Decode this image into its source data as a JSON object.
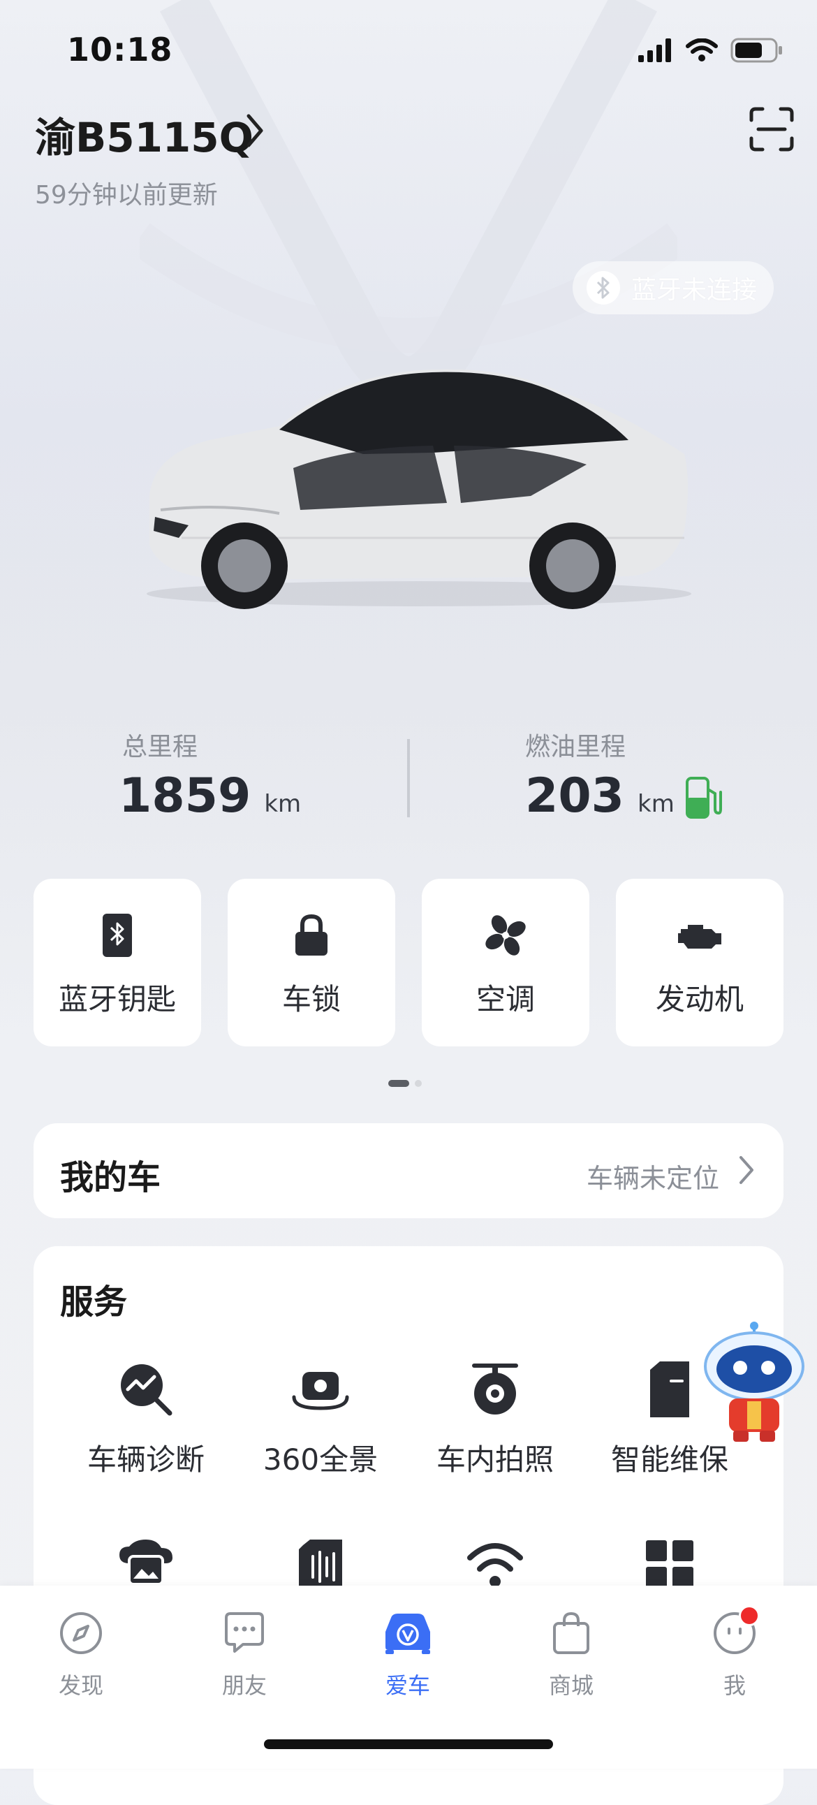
{
  "status_bar": {
    "time": "10:18",
    "icons": [
      "signal-icon",
      "wifi-icon",
      "battery-icon"
    ]
  },
  "header": {
    "plate": "渝B5115Q",
    "updated": "59分钟以前更新",
    "scan_icon": "scan-icon"
  },
  "bluetooth": {
    "label": "蓝牙未连接",
    "icon": "bluetooth-icon"
  },
  "mileage": {
    "total": {
      "label": "总里程",
      "value": "1859",
      "unit": "km"
    },
    "fuel": {
      "label": "燃油里程",
      "value": "203",
      "unit": "km",
      "icon": "fuel-pump-icon"
    }
  },
  "quick_actions": [
    {
      "label": "蓝牙钥匙",
      "icon": "bluetooth-key-icon"
    },
    {
      "label": "车锁",
      "icon": "lock-icon"
    },
    {
      "label": "空调",
      "icon": "fan-icon"
    },
    {
      "label": "发动机",
      "icon": "engine-icon"
    }
  ],
  "pager": {
    "pages": 2,
    "current": 1
  },
  "my_car": {
    "title": "我的车",
    "status": "车辆未定位"
  },
  "services": {
    "title": "服务",
    "items": [
      {
        "label": "车辆诊断",
        "icon": "diagnosis-icon"
      },
      {
        "label": "360全景",
        "icon": "panorama-camera-icon"
      },
      {
        "label": "车内拍照",
        "icon": "in-car-camera-icon"
      },
      {
        "label": "智能维保",
        "icon": "maintenance-icon"
      },
      {
        "label": "",
        "icon": "cloud-photo-icon"
      },
      {
        "label": "",
        "icon": "recorder-icon"
      },
      {
        "label": "",
        "icon": "wifi-icon"
      },
      {
        "label": "",
        "icon": "grid-icon"
      }
    ]
  },
  "tabbar": {
    "tabs": [
      {
        "label": "发现",
        "icon": "compass-icon"
      },
      {
        "label": "朋友",
        "icon": "chat-icon"
      },
      {
        "label": "爱车",
        "icon": "car-icon"
      },
      {
        "label": "商城",
        "icon": "shopping-bag-icon"
      },
      {
        "label": "我",
        "icon": "profile-icon"
      }
    ],
    "active": "爱车"
  },
  "colors": {
    "accent": "#3b6ef5",
    "badge": "#ee2b2b",
    "fuel": "#3fae55"
  }
}
